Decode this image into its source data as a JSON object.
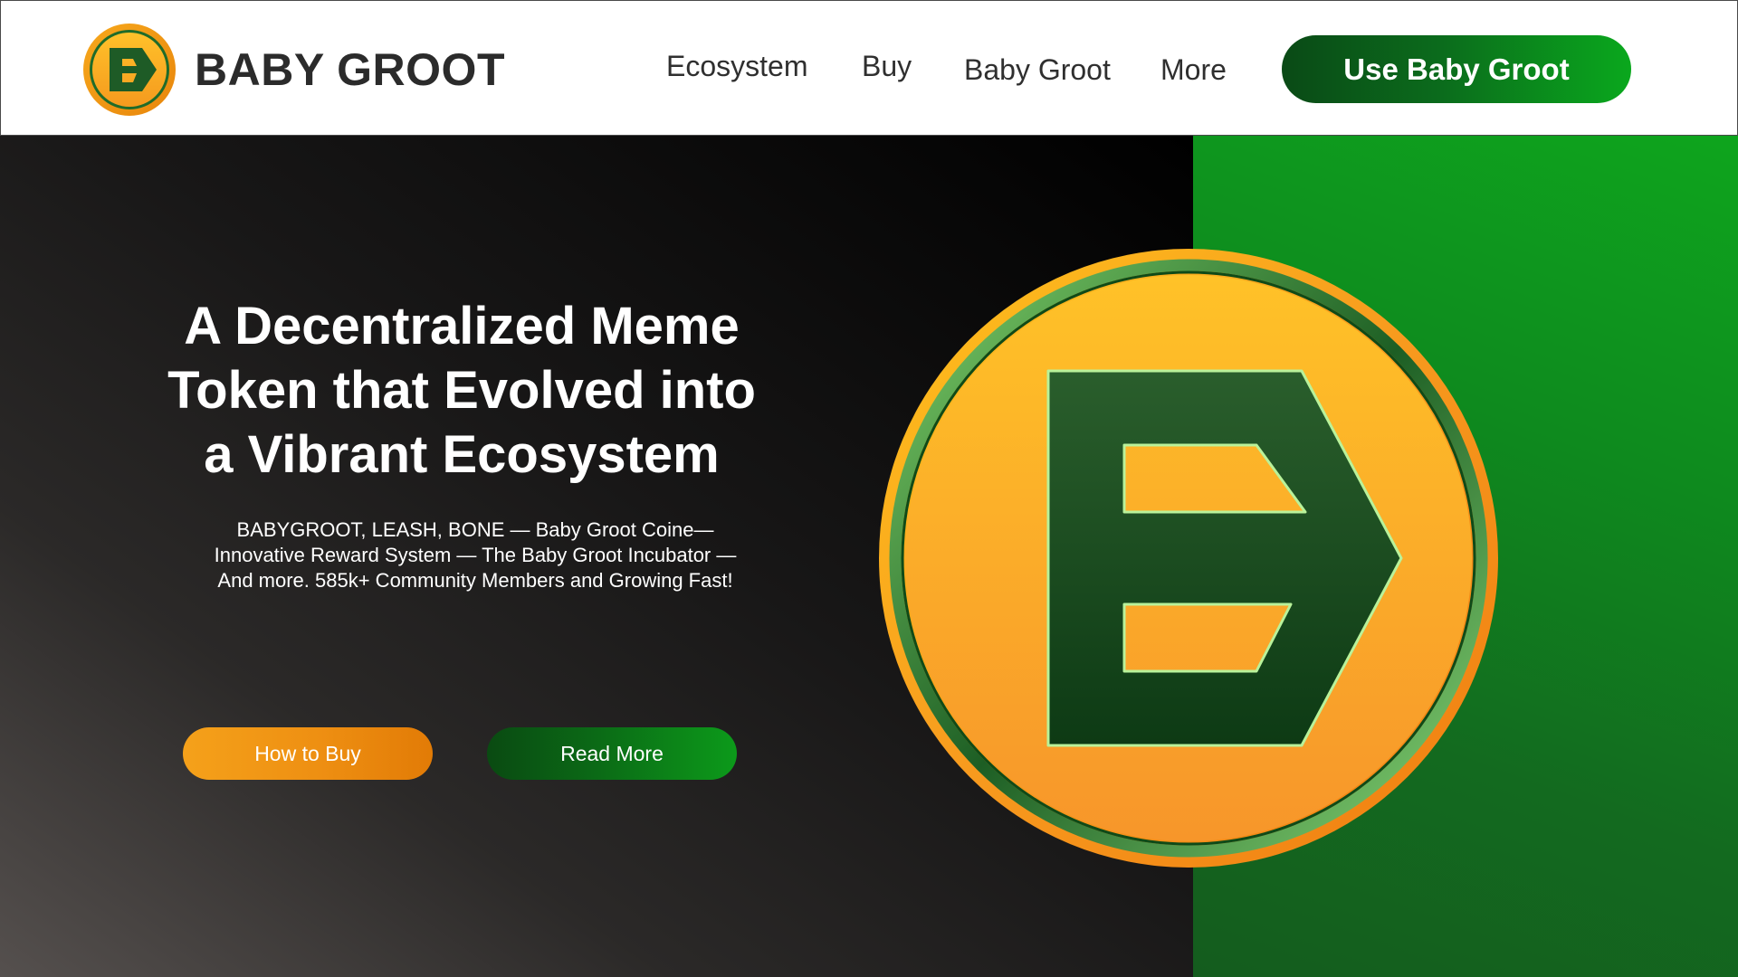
{
  "header": {
    "brand_name": "BABY GROOT",
    "nav": [
      {
        "label": "Ecosystem"
      },
      {
        "label": "Buy"
      },
      {
        "label": "Baby Groot"
      },
      {
        "label": "More"
      }
    ],
    "cta_label": "Use Baby Groot"
  },
  "hero": {
    "headline_lines": [
      "A Decentralized Meme",
      "Token that Evolved into",
      "a Vibrant Ecosystem"
    ],
    "subtext_lines": [
      "BABYGROOT, LEASH, BONE — Baby Groot  Coine—",
      "Innovative Reward System — The Baby Groot Incubator —",
      "And more. 585k+ Community Members and Growing Fast!"
    ],
    "buttons": {
      "how_to_buy": "How to Buy",
      "read_more": "Read More"
    }
  },
  "icons": {
    "logo": "baby-groot-coin-logo-icon",
    "hero_coin": "baby-groot-coin-icon"
  },
  "colors": {
    "brand_green": "#0b6b1c",
    "brand_orange": "#f5a11a",
    "hero_dark": "#181717",
    "text_dark": "#2b2b2b"
  }
}
